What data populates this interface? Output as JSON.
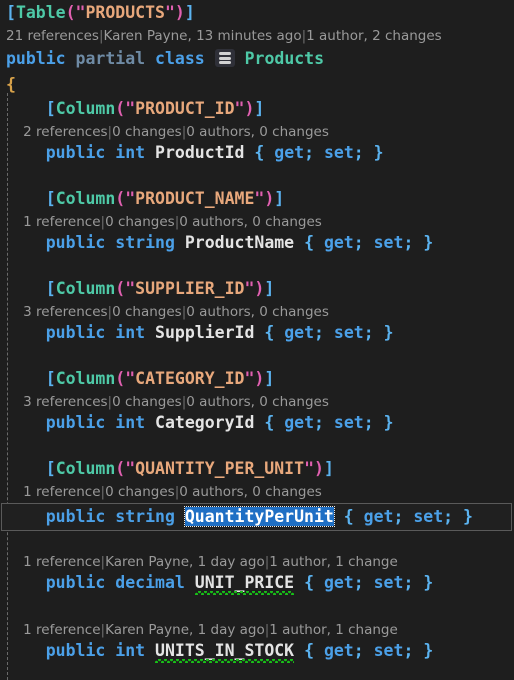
{
  "editor": {
    "language": "csharp",
    "background_color": "#1e1e1e",
    "guide_color": "#6a6a6a"
  },
  "colors": {
    "keyword": "#4ba0e8",
    "keyword_dim": "#6f8ba5",
    "type": "#4ec9a7",
    "string": "#e8a87c",
    "bracket": "#5bb3f0",
    "paren": "#e060b0",
    "identifier": "#e4e4e4",
    "class_brace": "#d8a24a",
    "codelens": "#9a9a9a",
    "selection": "#1f6fc4",
    "squiggle": "#18c018",
    "current_line_border": "#5a5a5a"
  },
  "class_declaration": {
    "attribute": {
      "open_bracket": "[",
      "name": "Table",
      "open_paren": "(",
      "quote": "\"",
      "value": "PRODUCTS",
      "close_paren": ")",
      "close_bracket": "]"
    },
    "codelens": {
      "references": "21 references",
      "author_change": "Karen Payne, 13 minutes ago",
      "authors_changes": "1 author, 2 changes",
      "separator": "|"
    },
    "modifier_public": "public",
    "modifier_partial": "partial",
    "keyword_class": "class",
    "icon": "database-stack-icon",
    "name": "Products",
    "open_brace": "{"
  },
  "members": [
    {
      "attribute": {
        "open_bracket": "[",
        "name": "Column",
        "open_paren": "(",
        "quote": "\"",
        "value": "PRODUCT_ID",
        "close_paren": ")",
        "close_bracket": "]"
      },
      "codelens": {
        "references": "2 references",
        "changes": "0 changes",
        "authors_changes": "0 authors, 0 changes",
        "separator": "|"
      },
      "modifier": "public",
      "type": "int",
      "identifier": "ProductId",
      "accessors": {
        "open": "{",
        "get": "get",
        "semi1": ";",
        "set": "set",
        "semi2": ";",
        "close": "}"
      },
      "selected": false,
      "squiggly": false,
      "current_line": false
    },
    {
      "attribute": {
        "open_bracket": "[",
        "name": "Column",
        "open_paren": "(",
        "quote": "\"",
        "value": "PRODUCT_NAME",
        "close_paren": ")",
        "close_bracket": "]"
      },
      "codelens": {
        "references": "1 reference",
        "changes": "0 changes",
        "authors_changes": "0 authors, 0 changes",
        "separator": "|"
      },
      "modifier": "public",
      "type": "string",
      "identifier": "ProductName",
      "accessors": {
        "open": "{",
        "get": "get",
        "semi1": ";",
        "set": "set",
        "semi2": ";",
        "close": "}"
      },
      "selected": false,
      "squiggly": false,
      "current_line": false
    },
    {
      "attribute": {
        "open_bracket": "[",
        "name": "Column",
        "open_paren": "(",
        "quote": "\"",
        "value": "SUPPLIER_ID",
        "close_paren": ")",
        "close_bracket": "]"
      },
      "codelens": {
        "references": "3 references",
        "changes": "0 changes",
        "authors_changes": "0 authors, 0 changes",
        "separator": "|"
      },
      "modifier": "public",
      "type": "int",
      "identifier": "SupplierId",
      "accessors": {
        "open": "{",
        "get": "get",
        "semi1": ";",
        "set": "set",
        "semi2": ";",
        "close": "}"
      },
      "selected": false,
      "squiggly": false,
      "current_line": false
    },
    {
      "attribute": {
        "open_bracket": "[",
        "name": "Column",
        "open_paren": "(",
        "quote": "\"",
        "value": "CATEGORY_ID",
        "close_paren": ")",
        "close_bracket": "]"
      },
      "codelens": {
        "references": "3 references",
        "changes": "0 changes",
        "authors_changes": "0 authors, 0 changes",
        "separator": "|"
      },
      "modifier": "public",
      "type": "int",
      "identifier": "CategoryId",
      "accessors": {
        "open": "{",
        "get": "get",
        "semi1": ";",
        "set": "set",
        "semi2": ";",
        "close": "}"
      },
      "selected": false,
      "squiggly": false,
      "current_line": false
    },
    {
      "attribute": {
        "open_bracket": "[",
        "name": "Column",
        "open_paren": "(",
        "quote": "\"",
        "value": "QUANTITY_PER_UNIT",
        "close_paren": ")",
        "close_bracket": "]"
      },
      "codelens": {
        "references": "1 reference",
        "changes": "0 changes",
        "authors_changes": "0 authors, 0 changes",
        "separator": "|"
      },
      "modifier": "public",
      "type": "string",
      "identifier": "QuantityPerUnit",
      "accessors": {
        "open": "{",
        "get": "get",
        "semi1": ";",
        "set": "set",
        "semi2": ";",
        "close": "}"
      },
      "selected": true,
      "squiggly": false,
      "current_line": true
    },
    {
      "attribute": null,
      "codelens": {
        "references": "1 reference",
        "author_change": "Karen Payne, 1 day ago",
        "authors_changes": "1 author, 1 change",
        "separator": "|"
      },
      "modifier": "public",
      "type": "decimal",
      "identifier": "UNIT_PRICE",
      "accessors": {
        "open": "{",
        "get": "get",
        "semi1": ";",
        "set": "set",
        "semi2": ";",
        "close": "}"
      },
      "selected": false,
      "squiggly": true,
      "current_line": false
    },
    {
      "attribute": null,
      "codelens": {
        "references": "1 reference",
        "author_change": "Karen Payne, 1 day ago",
        "authors_changes": "1 author, 1 change",
        "separator": "|"
      },
      "modifier": "public",
      "type": "int",
      "identifier": "UNITS_IN_STOCK",
      "accessors": {
        "open": "{",
        "get": "get",
        "semi1": ";",
        "set": "set",
        "semi2": ";",
        "close": "}"
      },
      "selected": false,
      "squiggly": true,
      "current_line": false
    }
  ]
}
